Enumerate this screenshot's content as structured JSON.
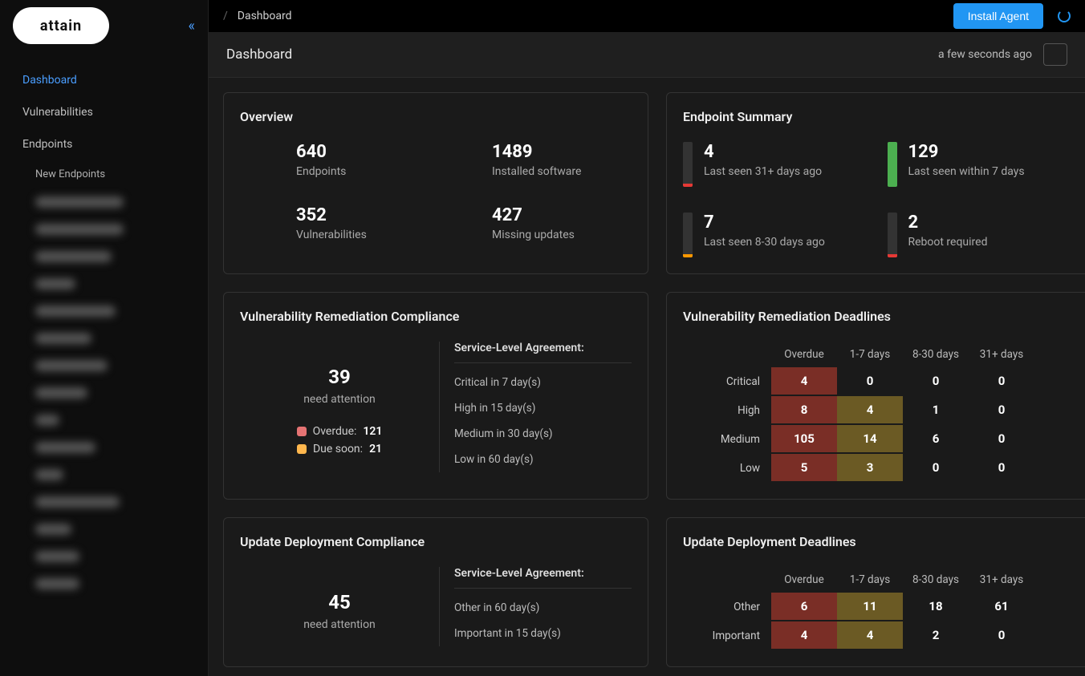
{
  "app_name": "attain",
  "breadcrumb": {
    "sep": "/",
    "current": "Dashboard"
  },
  "install_button": "Install Agent",
  "page_title": "Dashboard",
  "last_refresh": "a few seconds ago",
  "sidebar": {
    "items": [
      {
        "label": "Dashboard",
        "active": true
      },
      {
        "label": "Vulnerabilities",
        "active": false
      },
      {
        "label": "Endpoints",
        "active": false
      }
    ],
    "sub_items": [
      {
        "label": "New Endpoints"
      }
    ]
  },
  "overview": {
    "title": "Overview",
    "stats": [
      {
        "value": "640",
        "label": "Endpoints"
      },
      {
        "value": "1489",
        "label": "Installed software"
      },
      {
        "value": "352",
        "label": "Vulnerabilities"
      },
      {
        "value": "427",
        "label": "Missing updates"
      }
    ]
  },
  "endpoint_summary": {
    "title": "Endpoint Summary",
    "stats": [
      {
        "value": "4",
        "label": "Last seen 31+ days ago",
        "bar": "red-tiny"
      },
      {
        "value": "129",
        "label": "Last seen within 7 days",
        "bar": "green"
      },
      {
        "value": "7",
        "label": "Last seen 8-30 days ago",
        "bar": "orange-tiny"
      },
      {
        "value": "2",
        "label": "Reboot required",
        "bar": "red-tiny2"
      }
    ]
  },
  "vuln_compliance": {
    "title": "Vulnerability Remediation Compliance",
    "big": "39",
    "sub": "need attention",
    "overdue_label": "Overdue:",
    "overdue_value": "121",
    "duesoon_label": "Due soon:",
    "duesoon_value": "21",
    "sla_head": "Service-Level Agreement:",
    "sla_rows": [
      "Critical in 7 day(s)",
      "High in 15 day(s)",
      "Medium in 30 day(s)",
      "Low in 60 day(s)"
    ]
  },
  "vuln_deadlines": {
    "title": "Vulnerability Remediation Deadlines",
    "cols": [
      "Overdue",
      "1-7 days",
      "8-30 days",
      "31+ days"
    ],
    "rows": [
      {
        "label": "Critical",
        "cells": [
          {
            "v": "4",
            "c": "bg-red"
          },
          {
            "v": "0",
            "c": "bg-plain"
          },
          {
            "v": "0",
            "c": "bg-plain"
          },
          {
            "v": "0",
            "c": "bg-plain"
          }
        ]
      },
      {
        "label": "High",
        "cells": [
          {
            "v": "8",
            "c": "bg-red"
          },
          {
            "v": "4",
            "c": "bg-orange"
          },
          {
            "v": "1",
            "c": "bg-plain"
          },
          {
            "v": "0",
            "c": "bg-plain"
          }
        ]
      },
      {
        "label": "Medium",
        "cells": [
          {
            "v": "105",
            "c": "bg-red"
          },
          {
            "v": "14",
            "c": "bg-orange"
          },
          {
            "v": "6",
            "c": "bg-plain"
          },
          {
            "v": "0",
            "c": "bg-plain"
          }
        ]
      },
      {
        "label": "Low",
        "cells": [
          {
            "v": "5",
            "c": "bg-red"
          },
          {
            "v": "3",
            "c": "bg-orange"
          },
          {
            "v": "0",
            "c": "bg-plain"
          },
          {
            "v": "0",
            "c": "bg-plain"
          }
        ]
      }
    ]
  },
  "update_compliance": {
    "title": "Update Deployment Compliance",
    "big": "45",
    "sub": "need attention",
    "sla_head": "Service-Level Agreement:",
    "sla_rows": [
      "Other in 60 day(s)",
      "Important in 15 day(s)"
    ]
  },
  "update_deadlines": {
    "title": "Update Deployment Deadlines",
    "cols": [
      "Overdue",
      "1-7 days",
      "8-30 days",
      "31+ days"
    ],
    "rows": [
      {
        "label": "Other",
        "cells": [
          {
            "v": "6",
            "c": "bg-red"
          },
          {
            "v": "11",
            "c": "bg-orange"
          },
          {
            "v": "18",
            "c": "bg-plain"
          },
          {
            "v": "61",
            "c": "bg-plain"
          }
        ]
      },
      {
        "label": "Important",
        "cells": [
          {
            "v": "4",
            "c": "bg-red"
          },
          {
            "v": "4",
            "c": "bg-orange"
          },
          {
            "v": "2",
            "c": "bg-plain"
          },
          {
            "v": "0",
            "c": "bg-plain"
          }
        ]
      }
    ]
  }
}
